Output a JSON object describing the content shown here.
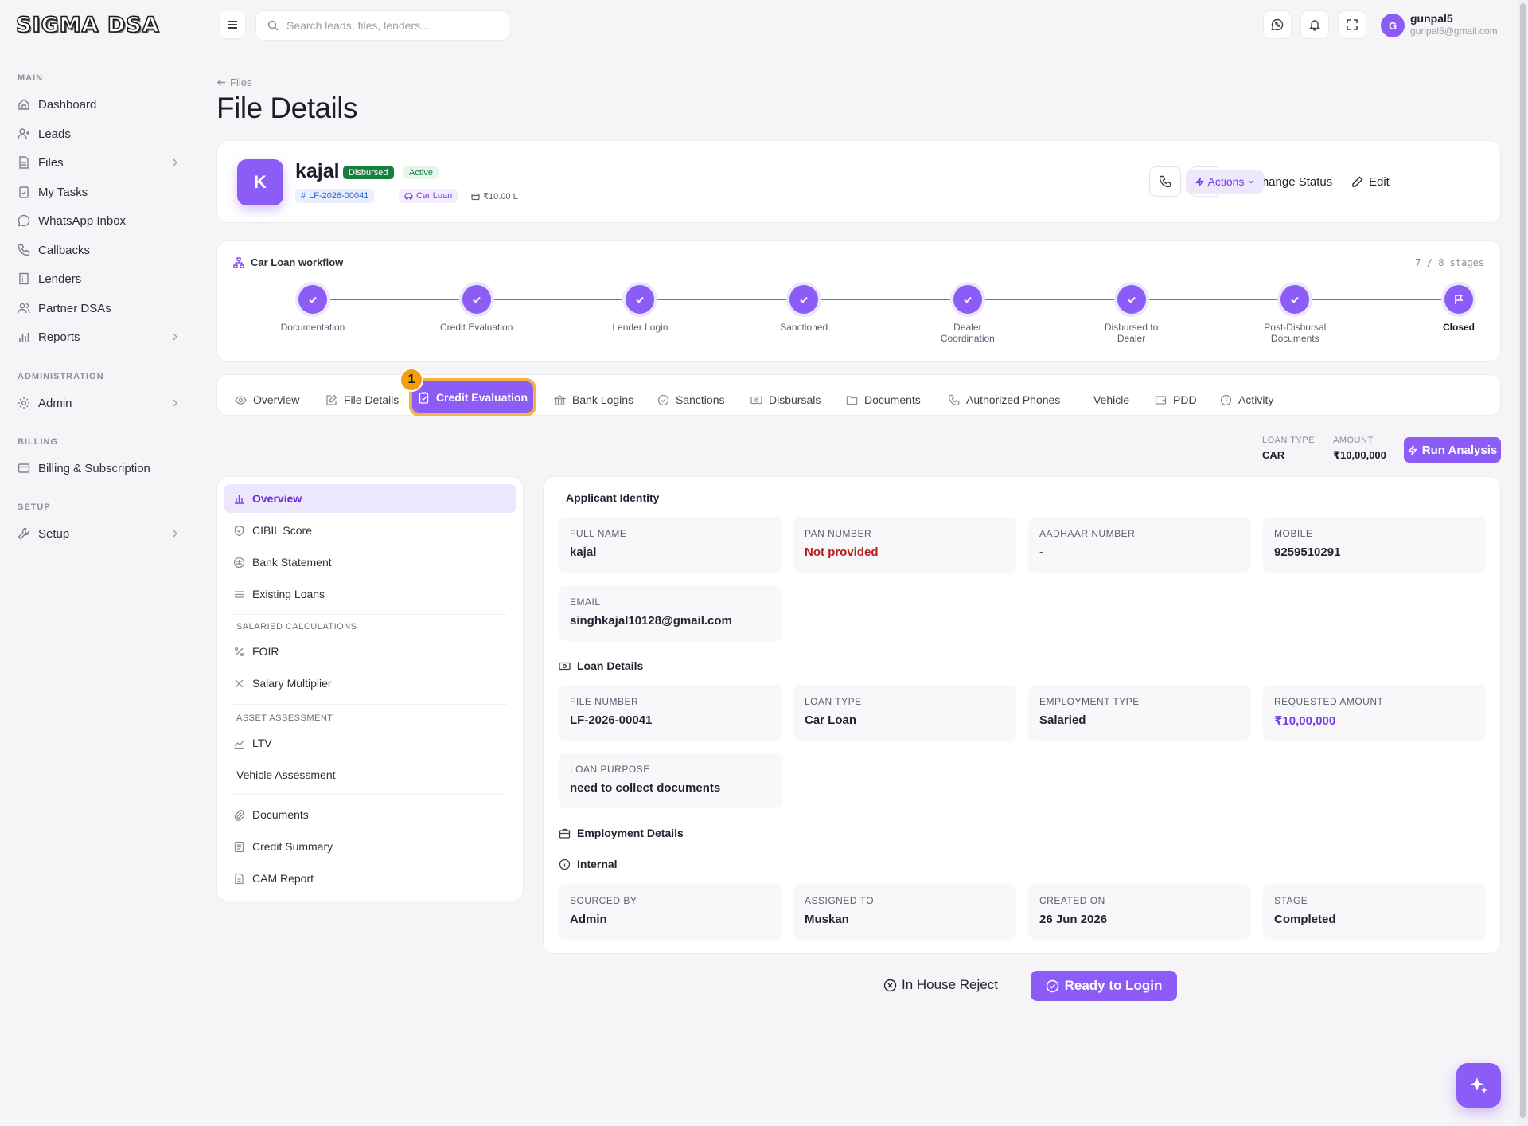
{
  "brand": {
    "logo_text": "SIGMA DSA",
    "accent": "#8b5cf6"
  },
  "search": {
    "placeholder": "Search leads, files, lenders..."
  },
  "user": {
    "initial": "G",
    "name": "gunpal5",
    "email": "gunpal5@gmail.com"
  },
  "sidebar": {
    "sections": [
      "MAIN",
      "ADMINISTRATION",
      "BILLING",
      "SETUP"
    ],
    "items": [
      {
        "label": "Dashboard",
        "icon": "home-icon"
      },
      {
        "label": "Leads",
        "icon": "user-plus-icon"
      },
      {
        "label": "Files",
        "icon": "file-icon",
        "expandable": true
      },
      {
        "label": "My Tasks",
        "icon": "clipboard-check-icon"
      },
      {
        "label": "WhatsApp Inbox",
        "icon": "whatsapp-icon"
      },
      {
        "label": "Callbacks",
        "icon": "phone-icon"
      },
      {
        "label": "Lenders",
        "icon": "building-icon"
      },
      {
        "label": "Partner DSAs",
        "icon": "users-icon"
      },
      {
        "label": "Reports",
        "icon": "bar-chart-icon",
        "expandable": true
      },
      {
        "label": "Admin",
        "icon": "gear-icon",
        "expandable": true
      },
      {
        "label": "Billing & Subscription",
        "icon": "credit-card-icon"
      },
      {
        "label": "Setup",
        "icon": "wrench-icon",
        "expandable": true
      }
    ]
  },
  "breadcrumb": {
    "back_label": "Files"
  },
  "page": {
    "title": "File Details"
  },
  "profile": {
    "initial": "K",
    "name": "kajal",
    "status_badge": "Disbursed",
    "state_badge": "Active",
    "file_number_chip": "LF-2026-00041",
    "loan_type_chip": "Car Loan",
    "amount_chip": "₹10.00 L",
    "buttons": {
      "change_status": "Change Status",
      "edit": "Edit",
      "actions": "Actions"
    }
  },
  "workflow": {
    "title": "Car Loan workflow",
    "progress": "7 / 8 stages",
    "completed": 7,
    "total": 8,
    "stages": [
      "Documentation",
      "Credit Evaluation",
      "Lender Login",
      "Sanctioned",
      "Dealer\nCoordination",
      "Disbursed to\nDealer",
      "Post-Disbursal\nDocuments",
      "Closed"
    ]
  },
  "tabs": [
    {
      "label": "Overview",
      "icon": "eye-icon"
    },
    {
      "label": "File Details",
      "icon": "edit-icon"
    },
    {
      "label": "Credit Evaluation",
      "icon": "clipboard-check-icon",
      "active": true
    },
    {
      "label": "Bank Logins",
      "icon": "bank-icon"
    },
    {
      "label": "Sanctions",
      "icon": "check-circle-icon"
    },
    {
      "label": "Disbursals",
      "icon": "banknote-icon"
    },
    {
      "label": "Documents",
      "icon": "folder-icon"
    },
    {
      "label": "Authorized Phones",
      "icon": "phone-icon"
    },
    {
      "label": "Vehicle",
      "icon": ""
    },
    {
      "label": "PDD",
      "icon": "wallet-icon"
    },
    {
      "label": "Activity",
      "icon": "clock-icon"
    }
  ],
  "step_marker": "1",
  "summary": {
    "loan_type_label": "LOAN TYPE",
    "loan_type_value": "CAR",
    "amount_label": "AMOUNT",
    "amount_value": "₹10,00,000",
    "run_button": "Run Analysis"
  },
  "credit_menu": {
    "items_top": [
      {
        "label": "Overview",
        "icon": "chart-icon",
        "active": true
      },
      {
        "label": "CIBIL Score",
        "icon": "shield-icon"
      },
      {
        "label": "Bank Statement",
        "icon": "bank-statement-icon"
      },
      {
        "label": "Existing Loans",
        "icon": "list-icon"
      }
    ],
    "salaried_section": "SALARIED CALCULATIONS",
    "items_salaried": [
      {
        "label": "FOIR",
        "icon": "percent-icon"
      },
      {
        "label": "Salary Multiplier",
        "icon": "multiply-icon"
      }
    ],
    "asset_section": "ASSET ASSESSMENT",
    "items_asset": [
      {
        "label": "LTV",
        "icon": "trend-icon"
      },
      {
        "label": "Vehicle Assessment",
        "icon": ""
      }
    ],
    "items_bottom": [
      {
        "label": "Documents",
        "icon": "paperclip-icon"
      },
      {
        "label": "Credit Summary",
        "icon": "document-icon"
      },
      {
        "label": "CAM Report",
        "icon": "report-icon"
      }
    ]
  },
  "details": {
    "applicant_identity": {
      "title": "Applicant Identity",
      "fields": [
        {
          "label": "FULL NAME",
          "value": "kajal"
        },
        {
          "label": "PAN NUMBER",
          "value": "Not provided"
        },
        {
          "label": "AADHAAR NUMBER",
          "value": "-"
        },
        {
          "label": "MOBILE",
          "value": "9259510291"
        },
        {
          "label": "EMAIL",
          "value": "singhkajal10128@gmail.com"
        }
      ]
    },
    "loan_details": {
      "title": "Loan Details",
      "fields": [
        {
          "label": "FILE NUMBER",
          "value": "LF-2026-00041"
        },
        {
          "label": "LOAN TYPE",
          "value": "Car Loan"
        },
        {
          "label": "EMPLOYMENT TYPE",
          "value": "Salaried"
        },
        {
          "label": "REQUESTED AMOUNT",
          "value": "₹10,00,000"
        },
        {
          "label": "LOAN PURPOSE",
          "value": "need to collect documents"
        }
      ]
    },
    "employment_details": {
      "title": "Employment Details"
    },
    "internal": {
      "title": "Internal",
      "fields": [
        {
          "label": "SOURCED BY",
          "value": "Admin"
        },
        {
          "label": "ASSIGNED TO",
          "value": "Muskan"
        },
        {
          "label": "CREATED ON",
          "value": "26 Jun 2026"
        },
        {
          "label": "STAGE",
          "value": "Completed"
        }
      ]
    }
  },
  "bottom_actions": {
    "reject": "In House Reject",
    "ready": "Ready to Login"
  }
}
